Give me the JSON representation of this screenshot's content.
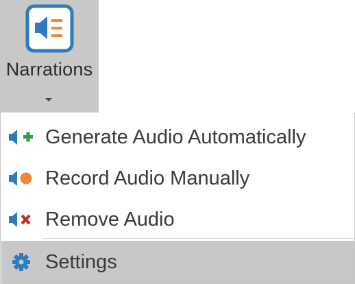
{
  "ribbon": {
    "label": "Narrations",
    "icon": "narrations-speaker-icon",
    "accent_color": "#2e7bbf",
    "icon_lines_color": "#f0883a"
  },
  "menu": {
    "items": [
      {
        "label": "Generate Audio Automatically",
        "icon": "speaker-plus-icon",
        "badge_color": "#2ea043"
      },
      {
        "label": "Record Audio Manually",
        "icon": "speaker-record-icon",
        "badge_color": "#f0883a"
      },
      {
        "label": "Remove Audio",
        "icon": "speaker-remove-icon",
        "badge_color": "#c0282d"
      },
      {
        "label": "Settings",
        "icon": "gear-icon",
        "highlighted": true
      }
    ]
  }
}
